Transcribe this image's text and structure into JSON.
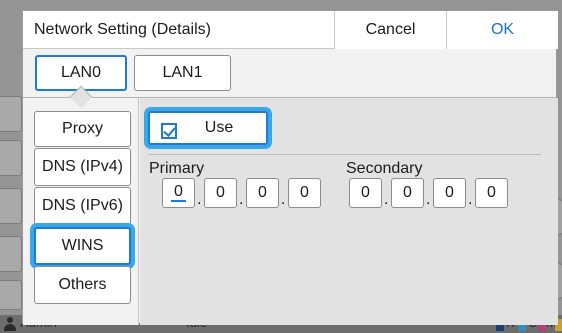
{
  "dialog": {
    "title": "Network Setting (Details)",
    "cancel_label": "Cancel",
    "ok_label": "OK"
  },
  "lan_tabs": [
    {
      "label": "LAN0",
      "selected": true
    },
    {
      "label": "LAN1",
      "selected": false
    }
  ],
  "side_menu": [
    {
      "label": "Proxy",
      "selected": false
    },
    {
      "label": "DNS (IPv4)",
      "selected": false
    },
    {
      "label": "DNS (IPv6)",
      "selected": false
    },
    {
      "label": "WINS",
      "selected": true
    },
    {
      "label": "Others",
      "selected": false
    }
  ],
  "use_toggle": {
    "label": "Use",
    "checked": true
  },
  "primary": {
    "label": "Primary",
    "octets": [
      "0",
      "0",
      "0",
      "0"
    ]
  },
  "secondary": {
    "label": "Secondary",
    "octets": [
      "0",
      "0",
      "0",
      "0"
    ]
  },
  "background_status": {
    "user": "Admin",
    "state": "Idle",
    "ink_letters": [
      "K",
      "C",
      "M",
      "Y"
    ]
  },
  "colors": {
    "accent": "#1e7bd0",
    "focus_ring": "#3aa7e8",
    "ok_text": "#1b73c6"
  }
}
